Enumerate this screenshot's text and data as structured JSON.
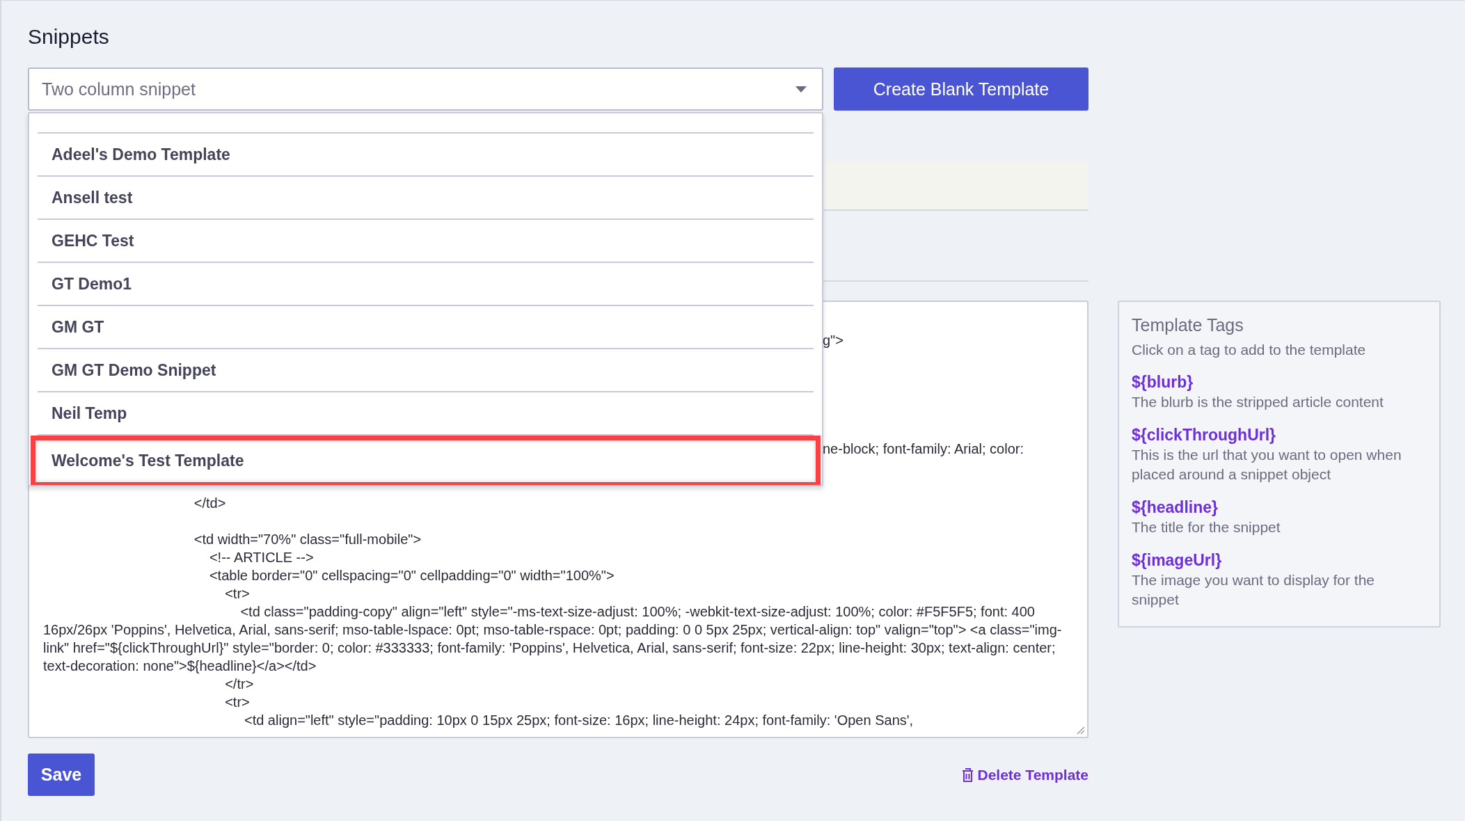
{
  "page": {
    "title": "Snippets"
  },
  "snippet_select": {
    "value": "Two column snippet",
    "expanded": true,
    "options": [
      {
        "label": "Adeel's Demo Template",
        "selected": false
      },
      {
        "label": "Ansell test",
        "selected": false
      },
      {
        "label": "GEHC Test",
        "selected": false
      },
      {
        "label": "GT Demo1",
        "selected": false
      },
      {
        "label": "GM GT",
        "selected": false
      },
      {
        "label": "GM GT Demo Snippet",
        "selected": false
      },
      {
        "label": "Neil Temp",
        "selected": false
      },
      {
        "label": "Welcome's Test Template",
        "selected": true
      }
    ]
  },
  "create_button": "Create Blank Template",
  "code_editor": {
    "lines": [
      {
        "kind": "fragment",
        "text": "g\">"
      },
      {
        "kind": "fragment",
        "text": "ne-block; font-family: Arial; color:"
      },
      {
        "kind": "line",
        "text": "                                       </td>"
      },
      {
        "kind": "blank"
      },
      {
        "kind": "line",
        "text": "                                       <td width=\"70%\" class=\"full-mobile\">"
      },
      {
        "kind": "line",
        "text": "                                           <!-- ARTICLE -->"
      },
      {
        "kind": "line",
        "text": "                                           <table border=\"0\" cellspacing=\"0\" cellpadding=\"0\" width=\"100%\">"
      },
      {
        "kind": "line",
        "text": "                                               <tr>"
      },
      {
        "kind": "line",
        "text": "                                                   <td class=\"padding-copy\" align=\"left\" style=\"-ms-text-size-adjust: 100%; -webkit-text-size-adjust: 100%; color: #F5F5F5; font: 400 16px/26px 'Poppins', Helvetica, Arial, sans-serif; mso-table-lspace: 0pt; mso-table-rspace: 0pt; padding: 0 0 5px 25px; vertical-align: top\" valign=\"top\"> <a class=\"img-link\" href=\"${clickThroughUrl}\" style=\"border: 0; color: #333333; font-family: 'Poppins', Helvetica, Arial, sans-serif; font-size: 22px; line-height: 30px; text-align: center; text-decoration: none\">${headline}</a></td>"
      },
      {
        "kind": "line",
        "text": "                                               </tr>"
      },
      {
        "kind": "line",
        "text": "                                               <tr>"
      },
      {
        "kind": "line",
        "text": "                                                    <td align=\"left\" style=\"padding: 10px 0 15px 25px; font-size: 16px; line-height: 24px; font-family: 'Open Sans',"
      }
    ]
  },
  "template_tags": {
    "title": "Template Tags",
    "hint": "Click on a tag to add to the template",
    "tags": [
      {
        "tag": "${blurb}",
        "description": "The blurb is the stripped article content"
      },
      {
        "tag": "${clickThroughUrl}",
        "description": "This is the url that you want to open when placed around a snippet object"
      },
      {
        "tag": "${headline}",
        "description": "The title for the snippet"
      },
      {
        "tag": "${imageUrl}",
        "description": "The image you want to display for the snippet"
      }
    ]
  },
  "save_button": "Save",
  "delete_link": "Delete Template"
}
